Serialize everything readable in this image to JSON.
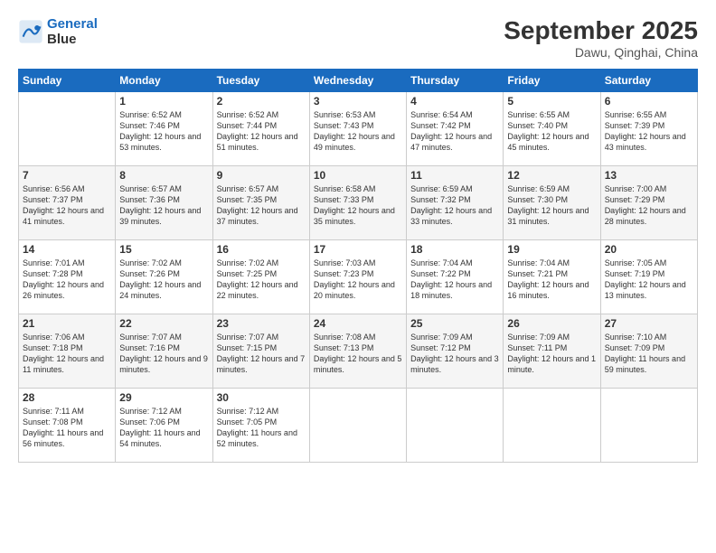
{
  "logo": {
    "line1": "General",
    "line2": "Blue"
  },
  "title": "September 2025",
  "location": "Dawu, Qinghai, China",
  "days_header": [
    "Sunday",
    "Monday",
    "Tuesday",
    "Wednesday",
    "Thursday",
    "Friday",
    "Saturday"
  ],
  "weeks": [
    [
      {
        "num": "",
        "sunrise": "",
        "sunset": "",
        "daylight": ""
      },
      {
        "num": "1",
        "sunrise": "Sunrise: 6:52 AM",
        "sunset": "Sunset: 7:46 PM",
        "daylight": "Daylight: 12 hours and 53 minutes."
      },
      {
        "num": "2",
        "sunrise": "Sunrise: 6:52 AM",
        "sunset": "Sunset: 7:44 PM",
        "daylight": "Daylight: 12 hours and 51 minutes."
      },
      {
        "num": "3",
        "sunrise": "Sunrise: 6:53 AM",
        "sunset": "Sunset: 7:43 PM",
        "daylight": "Daylight: 12 hours and 49 minutes."
      },
      {
        "num": "4",
        "sunrise": "Sunrise: 6:54 AM",
        "sunset": "Sunset: 7:42 PM",
        "daylight": "Daylight: 12 hours and 47 minutes."
      },
      {
        "num": "5",
        "sunrise": "Sunrise: 6:55 AM",
        "sunset": "Sunset: 7:40 PM",
        "daylight": "Daylight: 12 hours and 45 minutes."
      },
      {
        "num": "6",
        "sunrise": "Sunrise: 6:55 AM",
        "sunset": "Sunset: 7:39 PM",
        "daylight": "Daylight: 12 hours and 43 minutes."
      }
    ],
    [
      {
        "num": "7",
        "sunrise": "Sunrise: 6:56 AM",
        "sunset": "Sunset: 7:37 PM",
        "daylight": "Daylight: 12 hours and 41 minutes."
      },
      {
        "num": "8",
        "sunrise": "Sunrise: 6:57 AM",
        "sunset": "Sunset: 7:36 PM",
        "daylight": "Daylight: 12 hours and 39 minutes."
      },
      {
        "num": "9",
        "sunrise": "Sunrise: 6:57 AM",
        "sunset": "Sunset: 7:35 PM",
        "daylight": "Daylight: 12 hours and 37 minutes."
      },
      {
        "num": "10",
        "sunrise": "Sunrise: 6:58 AM",
        "sunset": "Sunset: 7:33 PM",
        "daylight": "Daylight: 12 hours and 35 minutes."
      },
      {
        "num": "11",
        "sunrise": "Sunrise: 6:59 AM",
        "sunset": "Sunset: 7:32 PM",
        "daylight": "Daylight: 12 hours and 33 minutes."
      },
      {
        "num": "12",
        "sunrise": "Sunrise: 6:59 AM",
        "sunset": "Sunset: 7:30 PM",
        "daylight": "Daylight: 12 hours and 31 minutes."
      },
      {
        "num": "13",
        "sunrise": "Sunrise: 7:00 AM",
        "sunset": "Sunset: 7:29 PM",
        "daylight": "Daylight: 12 hours and 28 minutes."
      }
    ],
    [
      {
        "num": "14",
        "sunrise": "Sunrise: 7:01 AM",
        "sunset": "Sunset: 7:28 PM",
        "daylight": "Daylight: 12 hours and 26 minutes."
      },
      {
        "num": "15",
        "sunrise": "Sunrise: 7:02 AM",
        "sunset": "Sunset: 7:26 PM",
        "daylight": "Daylight: 12 hours and 24 minutes."
      },
      {
        "num": "16",
        "sunrise": "Sunrise: 7:02 AM",
        "sunset": "Sunset: 7:25 PM",
        "daylight": "Daylight: 12 hours and 22 minutes."
      },
      {
        "num": "17",
        "sunrise": "Sunrise: 7:03 AM",
        "sunset": "Sunset: 7:23 PM",
        "daylight": "Daylight: 12 hours and 20 minutes."
      },
      {
        "num": "18",
        "sunrise": "Sunrise: 7:04 AM",
        "sunset": "Sunset: 7:22 PM",
        "daylight": "Daylight: 12 hours and 18 minutes."
      },
      {
        "num": "19",
        "sunrise": "Sunrise: 7:04 AM",
        "sunset": "Sunset: 7:21 PM",
        "daylight": "Daylight: 12 hours and 16 minutes."
      },
      {
        "num": "20",
        "sunrise": "Sunrise: 7:05 AM",
        "sunset": "Sunset: 7:19 PM",
        "daylight": "Daylight: 12 hours and 13 minutes."
      }
    ],
    [
      {
        "num": "21",
        "sunrise": "Sunrise: 7:06 AM",
        "sunset": "Sunset: 7:18 PM",
        "daylight": "Daylight: 12 hours and 11 minutes."
      },
      {
        "num": "22",
        "sunrise": "Sunrise: 7:07 AM",
        "sunset": "Sunset: 7:16 PM",
        "daylight": "Daylight: 12 hours and 9 minutes."
      },
      {
        "num": "23",
        "sunrise": "Sunrise: 7:07 AM",
        "sunset": "Sunset: 7:15 PM",
        "daylight": "Daylight: 12 hours and 7 minutes."
      },
      {
        "num": "24",
        "sunrise": "Sunrise: 7:08 AM",
        "sunset": "Sunset: 7:13 PM",
        "daylight": "Daylight: 12 hours and 5 minutes."
      },
      {
        "num": "25",
        "sunrise": "Sunrise: 7:09 AM",
        "sunset": "Sunset: 7:12 PM",
        "daylight": "Daylight: 12 hours and 3 minutes."
      },
      {
        "num": "26",
        "sunrise": "Sunrise: 7:09 AM",
        "sunset": "Sunset: 7:11 PM",
        "daylight": "Daylight: 12 hours and 1 minute."
      },
      {
        "num": "27",
        "sunrise": "Sunrise: 7:10 AM",
        "sunset": "Sunset: 7:09 PM",
        "daylight": "Daylight: 11 hours and 59 minutes."
      }
    ],
    [
      {
        "num": "28",
        "sunrise": "Sunrise: 7:11 AM",
        "sunset": "Sunset: 7:08 PM",
        "daylight": "Daylight: 11 hours and 56 minutes."
      },
      {
        "num": "29",
        "sunrise": "Sunrise: 7:12 AM",
        "sunset": "Sunset: 7:06 PM",
        "daylight": "Daylight: 11 hours and 54 minutes."
      },
      {
        "num": "30",
        "sunrise": "Sunrise: 7:12 AM",
        "sunset": "Sunset: 7:05 PM",
        "daylight": "Daylight: 11 hours and 52 minutes."
      },
      {
        "num": "",
        "sunrise": "",
        "sunset": "",
        "daylight": ""
      },
      {
        "num": "",
        "sunrise": "",
        "sunset": "",
        "daylight": ""
      },
      {
        "num": "",
        "sunrise": "",
        "sunset": "",
        "daylight": ""
      },
      {
        "num": "",
        "sunrise": "",
        "sunset": "",
        "daylight": ""
      }
    ]
  ]
}
